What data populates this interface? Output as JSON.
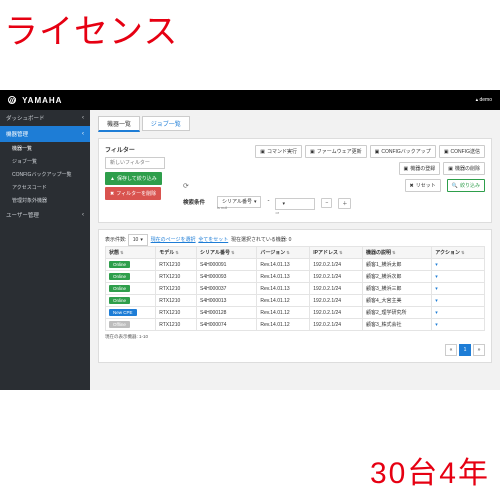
{
  "overlay": {
    "title": "ライセンス",
    "subtitle": "30台4年"
  },
  "topbar": {
    "brand": "YAMAHA",
    "user": "demo"
  },
  "sidebar": {
    "items": [
      {
        "label": "ダッシュボード",
        "hasSub": true
      },
      {
        "label": "機器管理",
        "hasSub": true,
        "active": true
      },
      {
        "label": "ユーザー管理",
        "hasSub": true
      }
    ],
    "subitems": [
      {
        "label": "機器一覧",
        "sel": true
      },
      {
        "label": "ジョブ一覧"
      },
      {
        "label": "CONFIGバックアップ一覧"
      },
      {
        "label": "アクセスコード"
      },
      {
        "label": "管理対象外機器"
      }
    ]
  },
  "tabs": {
    "active": "機器一覧",
    "other": "ジョブ一覧"
  },
  "filter": {
    "title": "フィルター",
    "placeholder": "新しいフィルター",
    "save": "保存して絞り込み",
    "delete": "フィルターを削除",
    "cond_label": "検索条件",
    "serial_label": "シリアル番号",
    "is_null": "is null",
    "blank": "",
    "or": "or"
  },
  "toolbar": {
    "cmd": "コマンド実行",
    "fw": "ファームウェア更新",
    "cfgbk": "CONFIGバックアップ",
    "cfgsd": "CONFIG送信",
    "reg": "機器の登録",
    "del": "機器の削除",
    "reset": "リセット",
    "apply": "絞り込み"
  },
  "table": {
    "perpage_lbl": "表示件数:",
    "perpage": "10",
    "selpage": "現在のページを選択",
    "allsel": "全てをセット",
    "selected": "現在選択されている機器: 0",
    "cols": [
      "状態",
      "モデル",
      "シリアル番号",
      "バージョン",
      "IPアドレス",
      "機器の説明",
      "アクション"
    ],
    "rows": [
      {
        "status": "Online",
        "scls": "b-online",
        "model": "RTX1210",
        "serial": "S4H000091",
        "ver": "Rev.14.01.13",
        "ip": "192.0.2.1/24",
        "desc": "顧客1_横浜太郎"
      },
      {
        "status": "Online",
        "scls": "b-online",
        "model": "RTX1210",
        "serial": "S4H000093",
        "ver": "Rev.14.01.13",
        "ip": "192.0.2.1/24",
        "desc": "顧客2_横浜次郎"
      },
      {
        "status": "Online",
        "scls": "b-online",
        "model": "RTX1210",
        "serial": "S4H000037",
        "ver": "Rev.14.01.13",
        "ip": "192.0.2.1/24",
        "desc": "顧客3_横浜三郎"
      },
      {
        "status": "Online",
        "scls": "b-online",
        "model": "RTX1210",
        "serial": "S4H000013",
        "ver": "Rev.14.01.12",
        "ip": "192.0.2.1/24",
        "desc": "顧客4_大宮主美"
      },
      {
        "status": "New CPE",
        "scls": "b-new",
        "model": "RTX1210",
        "serial": "S4H000128",
        "ver": "Rev.14.01.12",
        "ip": "192.0.2.1/24",
        "desc": "顧客2_理学研究所"
      },
      {
        "status": "Offline",
        "scls": "b-off",
        "model": "RTX1210",
        "serial": "S4H000074",
        "ver": "Rev.14.01.12",
        "ip": "192.0.2.1/24",
        "desc": "顧客3_株式会社"
      }
    ],
    "footer": "現在の表示機器: 1-10",
    "pager": {
      "prev": "«",
      "cur": "1",
      "next": "»"
    }
  }
}
